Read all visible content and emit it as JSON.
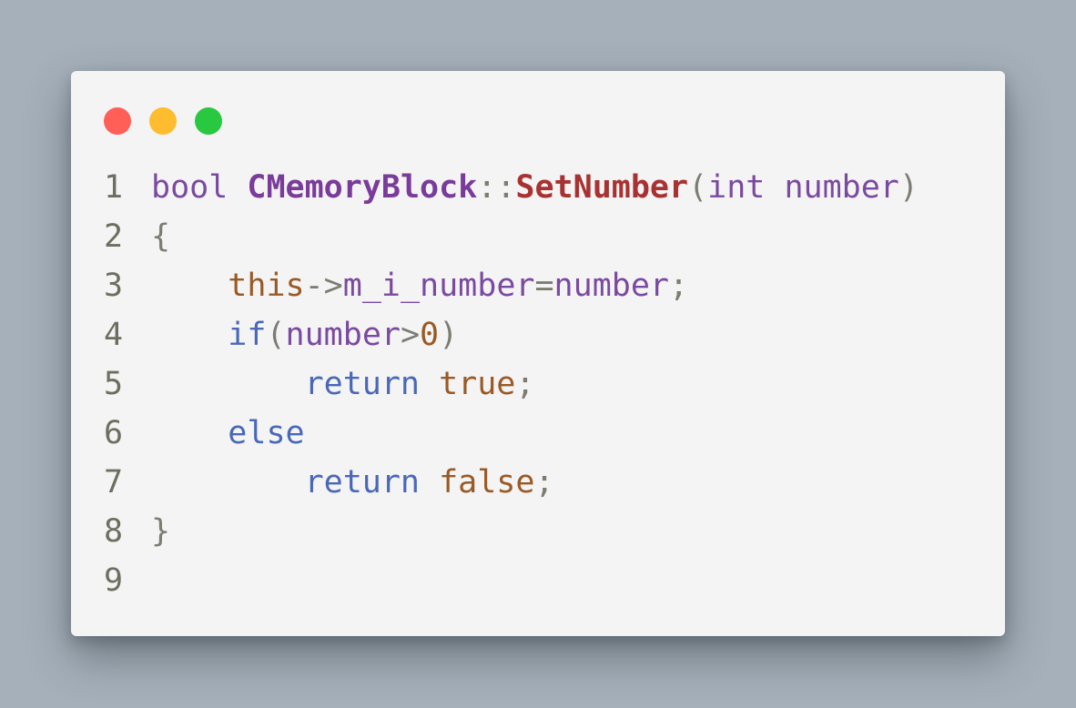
{
  "colors": {
    "background": "#a6b0ba",
    "panel": "#f4f4f4",
    "dot_close": "#ff5f57",
    "dot_minimize": "#febc2e",
    "dot_maximize": "#28c840"
  },
  "window_controls": [
    {
      "name": "close-dot",
      "color": "#ff5f57"
    },
    {
      "name": "minimize-dot",
      "color": "#febc2e"
    },
    {
      "name": "maximize-dot",
      "color": "#28c840"
    }
  ],
  "code": {
    "line_numbers": [
      "1",
      "2",
      "3",
      "4",
      "5",
      "6",
      "7",
      "8",
      "9"
    ],
    "line1": {
      "type": "bool",
      "space": " ",
      "cls": "CMemoryBlock",
      "scope": "::",
      "fn": "SetNumber",
      "open": "(",
      "param_type": "int",
      "space2": " ",
      "param": "number",
      "close": ")"
    },
    "line2": {
      "brace": "{"
    },
    "line3": {
      "indent": "    ",
      "this": "this",
      "arrow": "->",
      "member": "m_i_number",
      "eq": "=",
      "rhs": "number",
      "semi": ";"
    },
    "line4": {
      "indent": "    ",
      "kw": "if",
      "open": "(",
      "var": "number",
      "gt": ">",
      "num": "0",
      "close": ")"
    },
    "line5": {
      "indent": "        ",
      "kw": "return",
      "space": " ",
      "val": "true",
      "semi": ";"
    },
    "line6": {
      "indent": "    ",
      "kw": "else"
    },
    "line7": {
      "indent": "        ",
      "kw": "return",
      "space": " ",
      "val": "false",
      "semi": ";"
    },
    "line8": {
      "brace": "}"
    }
  }
}
